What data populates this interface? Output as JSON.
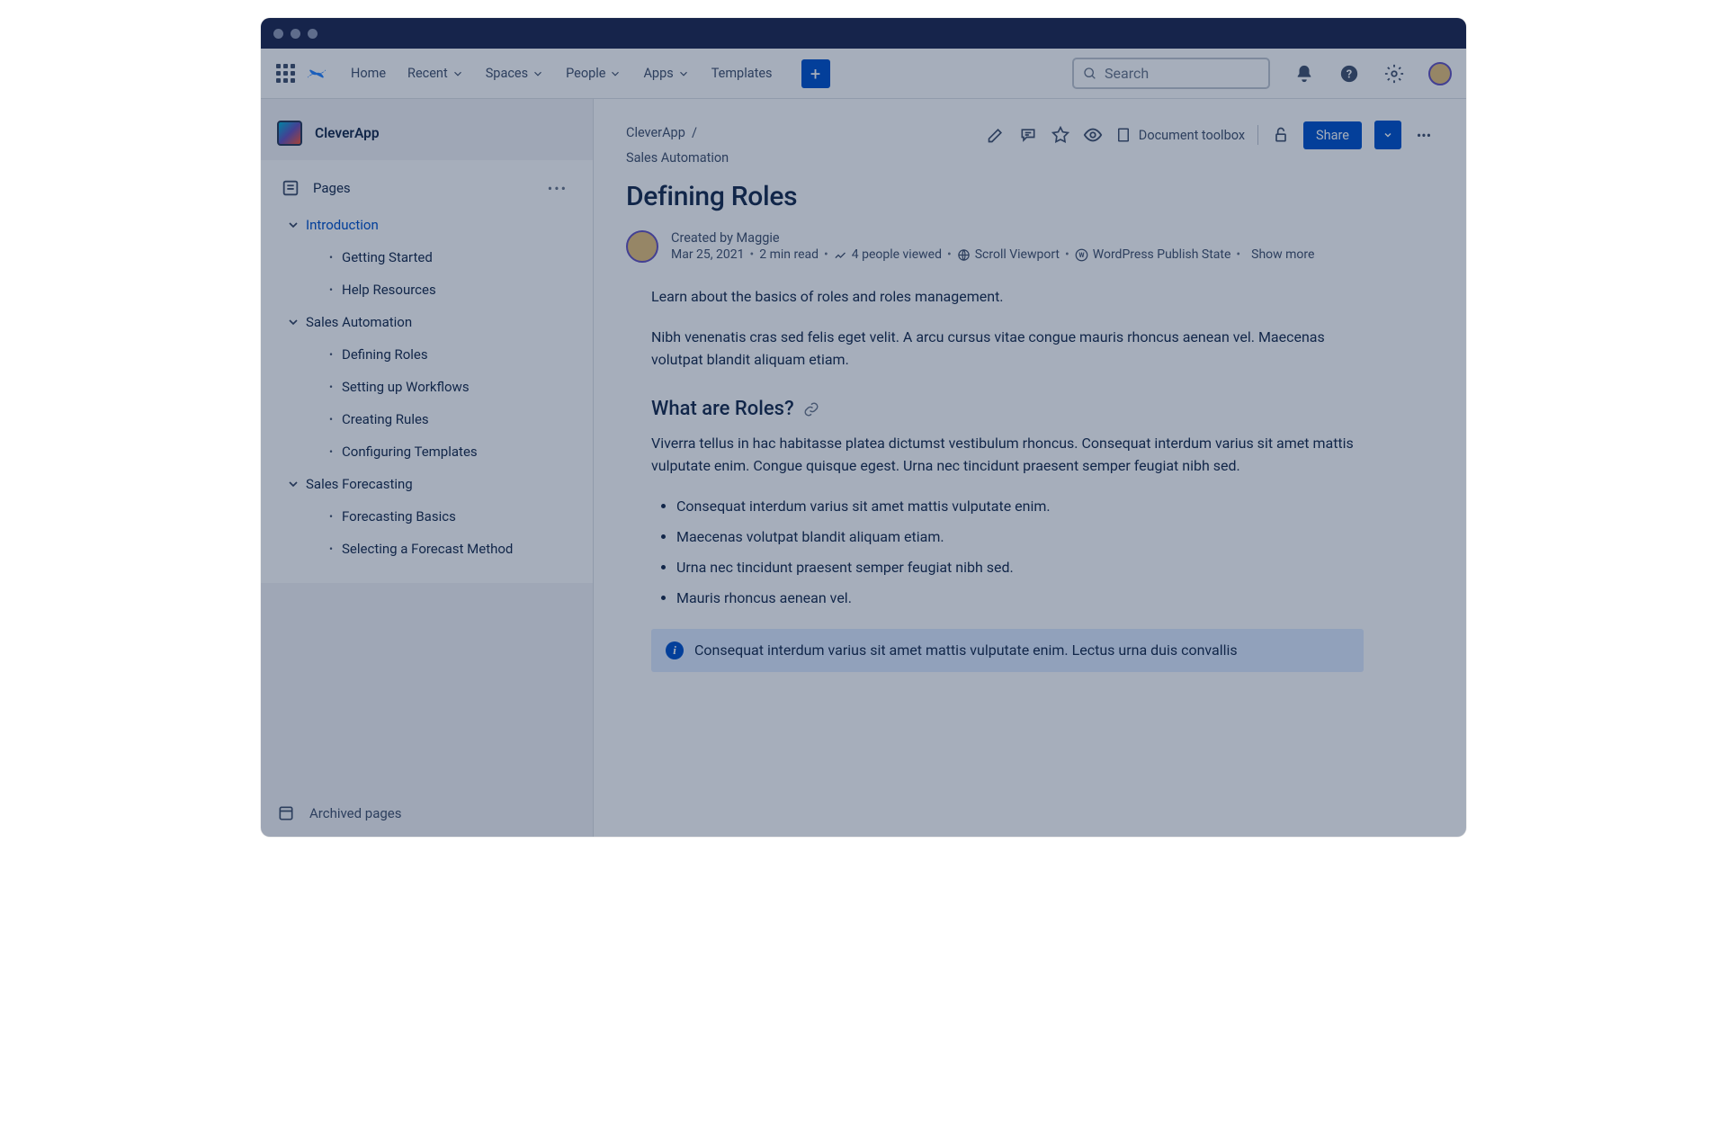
{
  "topnav": {
    "items": [
      "Home",
      "Recent",
      "Spaces",
      "People",
      "Apps",
      "Templates"
    ],
    "has_dropdown": [
      false,
      true,
      true,
      true,
      true,
      false
    ],
    "search_placeholder": "Search"
  },
  "sidebar": {
    "space_name": "CleverApp",
    "pages_label": "Pages",
    "archived_label": "Archived pages",
    "tree": [
      {
        "label": "Introduction",
        "type": "parent",
        "selected": true
      },
      {
        "label": "Getting Started",
        "type": "child"
      },
      {
        "label": "Help Resources",
        "type": "child"
      },
      {
        "label": "Sales Automation",
        "type": "parent"
      },
      {
        "label": "Defining Roles",
        "type": "child"
      },
      {
        "label": "Setting up Workflows",
        "type": "child"
      },
      {
        "label": "Creating Rules",
        "type": "child"
      },
      {
        "label": "Configuring Templates",
        "type": "child"
      },
      {
        "label": "Sales Forecasting",
        "type": "parent"
      },
      {
        "label": "Forecasting Basics",
        "type": "child"
      },
      {
        "label": "Selecting a Forecast Method",
        "type": "child"
      }
    ]
  },
  "page": {
    "breadcrumb": [
      "CleverApp",
      "Sales Automation"
    ],
    "title": "Defining Roles",
    "toolbox_label": "Document toolbox",
    "share_label": "Share",
    "byline": {
      "created_by": "Created by Maggie",
      "date": "Mar 25, 2021",
      "read_time": "2 min read",
      "viewed": "4 people viewed",
      "viewport": "Scroll Viewport",
      "wp_state": "WordPress Publish State",
      "show_more": "Show more"
    },
    "body": {
      "p1": "Learn about the basics of roles and roles management.",
      "p2": "Nibh venenatis cras sed felis eget velit. A arcu cursus vitae congue mauris rhoncus aenean vel. Maecenas volutpat blandit aliquam etiam.",
      "h2": "What are Roles?",
      "p3": "Viverra tellus in hac habitasse platea dictumst vestibulum rhoncus. Consequat interdum varius sit amet mattis vulputate enim. Congue quisque egest. Urna nec tincidunt praesent semper feugiat nibh sed.",
      "bullets": [
        "Consequat interdum varius sit amet mattis vulputate enim.",
        "Maecenas volutpat blandit aliquam etiam.",
        "Urna nec tincidunt praesent semper feugiat nibh sed.",
        "Mauris rhoncus aenean vel."
      ],
      "info": "Consequat interdum varius sit amet mattis vulputate enim. Lectus urna duis convallis"
    }
  }
}
